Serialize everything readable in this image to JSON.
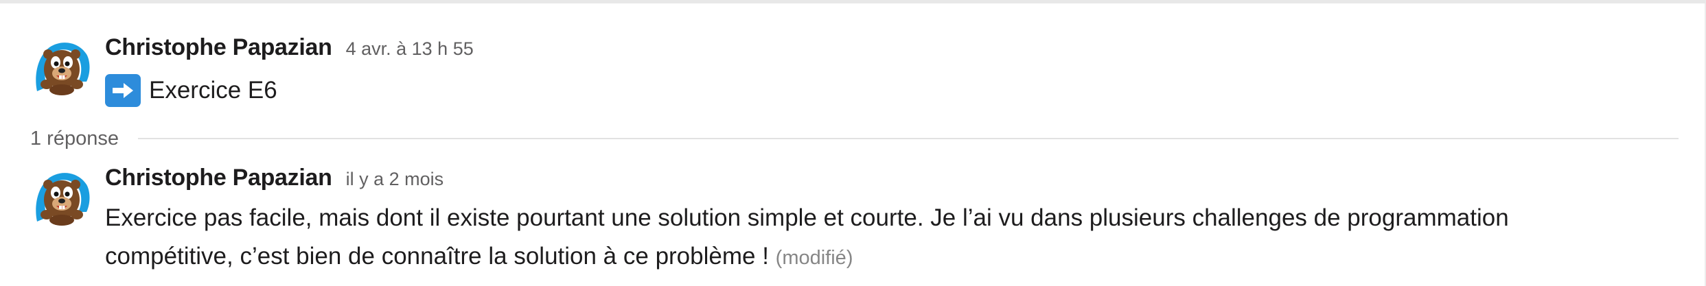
{
  "messages": [
    {
      "author": "Christophe Papazian",
      "timestamp": "4 avr. à 13 h 55",
      "emoji": "arrow-right-emoji",
      "text": "Exercice E6"
    },
    {
      "author": "Christophe Papazian",
      "timestamp": "il y a 2 mois",
      "text_line1": "Exercice pas facile, mais dont il existe pourtant une solution simple et courte. Je l’ai vu dans plusieurs challenges de programmation",
      "text_line2": "compétitive, c’est bien de connaître la solution à ce problème !",
      "edited": "(modifié)"
    }
  ],
  "thread": {
    "replies_label": "1 réponse"
  },
  "colors": {
    "avatar_ring": "#1a9ee0",
    "emoji_bg": "#2d8cdb",
    "text": "#1d1c1d",
    "muted": "#616061"
  }
}
